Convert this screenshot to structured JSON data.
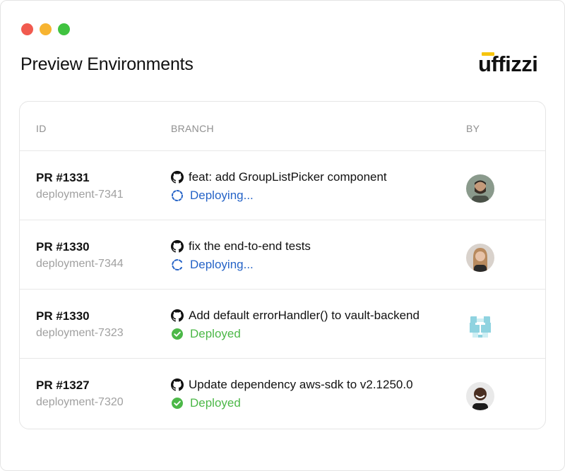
{
  "window": {
    "traffic_lights": [
      {
        "name": "close",
        "color": "#f15a4f"
      },
      {
        "name": "minimize",
        "color": "#f7b431"
      },
      {
        "name": "maximize",
        "color": "#40c340"
      }
    ]
  },
  "header": {
    "title": "Preview Environments",
    "logo_text": "uffizzi",
    "logo_accent": "#f6c40d"
  },
  "table": {
    "columns": [
      "ID",
      "BRANCH",
      "BY"
    ],
    "rows": [
      {
        "pr": "PR #1331",
        "deployment": "deployment-7341",
        "commit": "feat: add GroupListPicker component",
        "status": "Deploying...",
        "status_type": "deploying",
        "avatar": "avatar-bearded-man"
      },
      {
        "pr": "PR #1330",
        "deployment": "deployment-7344",
        "commit": "fix the end-to-end tests",
        "status": "Deploying...",
        "status_type": "deploying",
        "avatar": "avatar-woman"
      },
      {
        "pr": "PR #1330",
        "deployment": "deployment-7323",
        "commit": "Add default errorHandler() to vault-backend",
        "status": "Deployed",
        "status_type": "deployed",
        "avatar": "avatar-identicon"
      },
      {
        "pr": "PR #1327",
        "deployment": "deployment-7320",
        "commit": "Update dependency aws-sdk to v2.1250.0",
        "status": "Deployed",
        "status_type": "deployed",
        "avatar": "avatar-man-smiling"
      }
    ]
  },
  "colors": {
    "deploying": "#2563c7",
    "deployed": "#4cb848",
    "muted": "#a0a0a0"
  }
}
